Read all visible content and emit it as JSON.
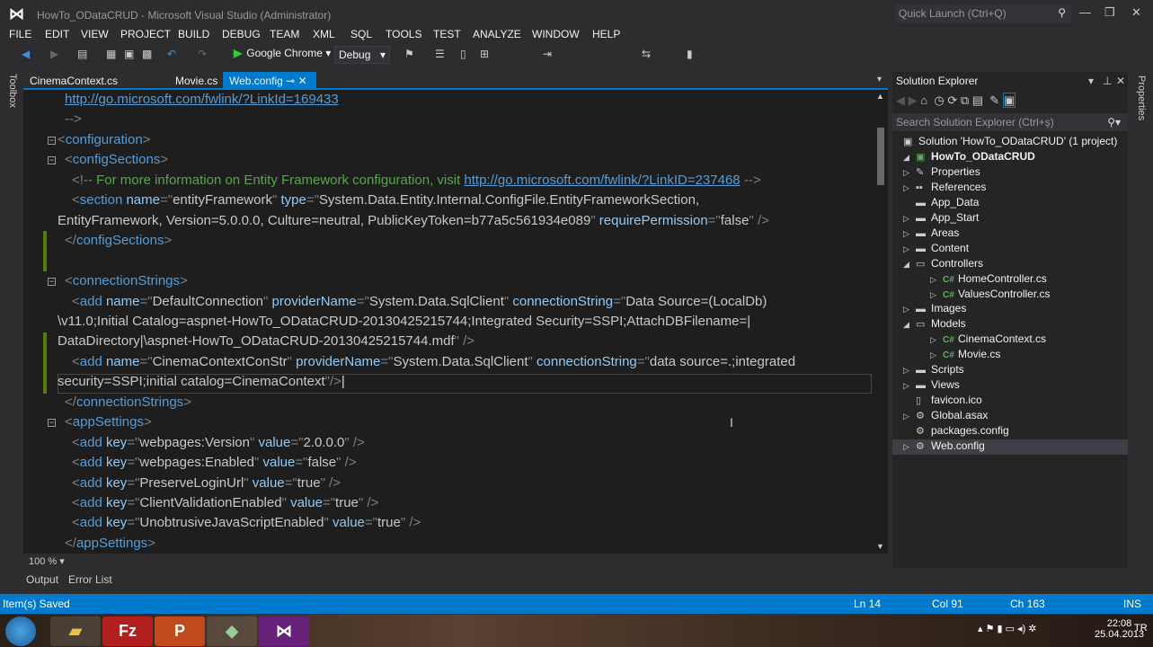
{
  "window": {
    "title": "HowTo_ODataCRUD - Microsoft Visual Studio (Administrator)",
    "quick_launch_placeholder": "Quick Launch (Ctrl+Q)"
  },
  "menu": [
    "FILE",
    "EDIT",
    "VIEW",
    "PROJECT",
    "BUILD",
    "DEBUG",
    "TEAM",
    "XML",
    "SQL",
    "TOOLS",
    "TEST",
    "ANALYZE",
    "WINDOW",
    "HELP"
  ],
  "toolbar": {
    "run_target": "Google Chrome",
    "configuration": "Debug"
  },
  "toolbox_label": "Toolbox",
  "tabs": [
    {
      "label": "CinemaContext.cs"
    },
    {
      "label": "Movie.cs"
    },
    {
      "label": "Web.config",
      "active": true
    }
  ],
  "code": [
    [
      [
        "l",
        "http://go.microsoft.com/fwlink/?LinkId=169433"
      ]
    ],
    [
      [
        "p",
        "-->"
      ]
    ],
    [
      [
        "p",
        "<"
      ],
      [
        "e",
        "configuration"
      ],
      [
        "p",
        ">"
      ]
    ],
    [
      [
        "p",
        "<"
      ],
      [
        "e",
        "configSections"
      ],
      [
        "p",
        ">"
      ]
    ],
    [
      [
        "p",
        "<!--"
      ],
      [
        "c",
        " For more information on Entity Framework configuration, visit "
      ],
      [
        "l",
        "http://go.microsoft.com/fwlink/?LinkID=237468"
      ],
      [
        "p",
        " -->"
      ]
    ],
    [
      [
        "p",
        "<"
      ],
      [
        "e",
        "section"
      ],
      [
        "a",
        " name"
      ],
      [
        "p",
        "=\""
      ],
      [
        "v",
        "entityFramework"
      ],
      [
        "p",
        "\""
      ],
      [
        "a",
        " type"
      ],
      [
        "p",
        "=\""
      ],
      [
        "v",
        "System.Data.Entity.Internal.ConfigFile.EntityFrameworkSection,"
      ]
    ],
    [
      [
        "v",
        "EntityFramework, Version=5.0.0.0, Culture=neutral, PublicKeyToken=b77a5c561934e089"
      ],
      [
        "p",
        "\""
      ],
      [
        "a",
        " requirePermission"
      ],
      [
        "p",
        "=\""
      ],
      [
        "v",
        "false"
      ],
      [
        "p",
        "\" />"
      ]
    ],
    [
      [
        "p",
        "</"
      ],
      [
        "e",
        "configSections"
      ],
      [
        "p",
        ">"
      ]
    ],
    [],
    [
      [
        "p",
        "<"
      ],
      [
        "e",
        "connectionStrings"
      ],
      [
        "p",
        ">"
      ]
    ],
    [
      [
        "p",
        "<"
      ],
      [
        "e",
        "add"
      ],
      [
        "a",
        " name"
      ],
      [
        "p",
        "=\""
      ],
      [
        "v",
        "DefaultConnection"
      ],
      [
        "p",
        "\""
      ],
      [
        "a",
        " providerName"
      ],
      [
        "p",
        "=\""
      ],
      [
        "v",
        "System.Data.SqlClient"
      ],
      [
        "p",
        "\""
      ],
      [
        "a",
        " connectionString"
      ],
      [
        "p",
        "=\""
      ],
      [
        "v",
        "Data Source=(LocalDb)"
      ]
    ],
    [
      [
        "v",
        "\\v11.0;Initial Catalog=aspnet-HowTo_ODataCRUD-20130425215744;Integrated Security=SSPI;AttachDBFilename=|"
      ]
    ],
    [
      [
        "v",
        "DataDirectory|\\aspnet-HowTo_ODataCRUD-20130425215744.mdf"
      ],
      [
        "p",
        "\" />"
      ]
    ],
    [
      [
        "p",
        "<"
      ],
      [
        "e",
        "add"
      ],
      [
        "a",
        " name"
      ],
      [
        "p",
        "=\""
      ],
      [
        "v",
        "CinemaContextConStr"
      ],
      [
        "p",
        "\""
      ],
      [
        "a",
        " providerName"
      ],
      [
        "p",
        "=\""
      ],
      [
        "v",
        "System.Data.SqlClient"
      ],
      [
        "p",
        "\""
      ],
      [
        "a",
        " connectionString"
      ],
      [
        "p",
        "=\""
      ],
      [
        "v",
        "data source=.;integrated"
      ]
    ],
    [
      [
        "v",
        "security=SSPI;initial catalog=CinemaContext"
      ],
      [
        "p",
        "\"/>"
      ],
      [
        "x",
        "|"
      ]
    ],
    [
      [
        "p",
        "</"
      ],
      [
        "e",
        "connectionStrings"
      ],
      [
        "p",
        ">"
      ]
    ],
    [
      [
        "p",
        "<"
      ],
      [
        "e",
        "appSettings"
      ],
      [
        "p",
        ">"
      ]
    ],
    [
      [
        "p",
        "<"
      ],
      [
        "e",
        "add"
      ],
      [
        "a",
        " key"
      ],
      [
        "p",
        "=\""
      ],
      [
        "v",
        "webpages:Version"
      ],
      [
        "p",
        "\""
      ],
      [
        "a",
        " value"
      ],
      [
        "p",
        "=\""
      ],
      [
        "v",
        "2.0.0.0"
      ],
      [
        "p",
        "\" />"
      ]
    ],
    [
      [
        "p",
        "<"
      ],
      [
        "e",
        "add"
      ],
      [
        "a",
        " key"
      ],
      [
        "p",
        "=\""
      ],
      [
        "v",
        "webpages:Enabled"
      ],
      [
        "p",
        "\""
      ],
      [
        "a",
        " value"
      ],
      [
        "p",
        "=\""
      ],
      [
        "v",
        "false"
      ],
      [
        "p",
        "\" />"
      ]
    ],
    [
      [
        "p",
        "<"
      ],
      [
        "e",
        "add"
      ],
      [
        "a",
        " key"
      ],
      [
        "p",
        "=\""
      ],
      [
        "v",
        "PreserveLoginUrl"
      ],
      [
        "p",
        "\""
      ],
      [
        "a",
        " value"
      ],
      [
        "p",
        "=\""
      ],
      [
        "v",
        "true"
      ],
      [
        "p",
        "\" />"
      ]
    ],
    [
      [
        "p",
        "<"
      ],
      [
        "e",
        "add"
      ],
      [
        "a",
        " key"
      ],
      [
        "p",
        "=\""
      ],
      [
        "v",
        "ClientValidationEnabled"
      ],
      [
        "p",
        "\""
      ],
      [
        "a",
        " value"
      ],
      [
        "p",
        "=\""
      ],
      [
        "v",
        "true"
      ],
      [
        "p",
        "\" />"
      ]
    ],
    [
      [
        "p",
        "<"
      ],
      [
        "e",
        "add"
      ],
      [
        "a",
        " key"
      ],
      [
        "p",
        "=\""
      ],
      [
        "v",
        "UnobtrusiveJavaScriptEnabled"
      ],
      [
        "p",
        "\""
      ],
      [
        "a",
        " value"
      ],
      [
        "p",
        "=\""
      ],
      [
        "v",
        "true"
      ],
      [
        "p",
        "\" />"
      ]
    ],
    [
      [
        "p",
        "</"
      ],
      [
        "e",
        "appSettings"
      ],
      [
        "p",
        ">"
      ]
    ]
  ],
  "editor": {
    "zoom": "100 %"
  },
  "bottom_tabs": [
    "Output",
    "Error List"
  ],
  "solution_explorer": {
    "title": "Solution Explorer",
    "search_placeholder": "Search Solution Explorer (Ctrl+ş)",
    "nodes": [
      {
        "label": "Solution 'HowTo_ODataCRUD' (1 project)",
        "icon": "solution-icon",
        "depth": 0,
        "arrow": ""
      },
      {
        "label": "HowTo_ODataCRUD",
        "icon": "project-icon",
        "depth": 0,
        "arrow": "open",
        "bold": true
      },
      {
        "label": "Properties",
        "icon": "wrench-icon",
        "depth": 1,
        "arrow": "closed"
      },
      {
        "label": "References",
        "icon": "references-icon",
        "depth": 1,
        "arrow": "closed"
      },
      {
        "label": "App_Data",
        "icon": "folder-icon",
        "depth": 1,
        "arrow": ""
      },
      {
        "label": "App_Start",
        "icon": "folder-icon",
        "depth": 1,
        "arrow": "closed"
      },
      {
        "label": "Areas",
        "icon": "folder-icon",
        "depth": 1,
        "arrow": "closed"
      },
      {
        "label": "Content",
        "icon": "folder-icon",
        "depth": 1,
        "arrow": "closed"
      },
      {
        "label": "Controllers",
        "icon": "folder-open-icon",
        "depth": 1,
        "arrow": "open"
      },
      {
        "label": "HomeController.cs",
        "icon": "csharp-file-icon",
        "depth": 2,
        "arrow": "closed"
      },
      {
        "label": "ValuesController.cs",
        "icon": "csharp-file-icon",
        "depth": 2,
        "arrow": "closed"
      },
      {
        "label": "Images",
        "icon": "folder-icon",
        "depth": 1,
        "arrow": "closed"
      },
      {
        "label": "Models",
        "icon": "folder-open-icon",
        "depth": 1,
        "arrow": "open"
      },
      {
        "label": "CinemaContext.cs",
        "icon": "csharp-file-icon",
        "depth": 2,
        "arrow": "closed"
      },
      {
        "label": "Movie.cs",
        "icon": "csharp-file-icon",
        "depth": 2,
        "arrow": "closed"
      },
      {
        "label": "Scripts",
        "icon": "folder-icon",
        "depth": 1,
        "arrow": "closed"
      },
      {
        "label": "Views",
        "icon": "folder-icon",
        "depth": 1,
        "arrow": "closed"
      },
      {
        "label": "favicon.ico",
        "icon": "file-icon",
        "depth": 1,
        "arrow": ""
      },
      {
        "label": "Global.asax",
        "icon": "config-file-icon",
        "depth": 1,
        "arrow": "closed"
      },
      {
        "label": "packages.config",
        "icon": "config-file-icon",
        "depth": 1,
        "arrow": ""
      },
      {
        "label": "Web.config",
        "icon": "config-file-icon",
        "depth": 1,
        "arrow": "closed",
        "selected": true
      }
    ]
  },
  "properties_label": "Properties",
  "status": {
    "message": "Item(s) Saved",
    "ln": "Ln 14",
    "col": "Col 91",
    "ch": "Ch 163",
    "mode": "INS"
  },
  "taskbar": {
    "language": "TR",
    "time": "22:08",
    "date": "25.04.2013"
  },
  "colors": {
    "accent": "#007acc",
    "editor_bg": "#1e1e1e",
    "chrome_bg": "#2d2d30"
  }
}
